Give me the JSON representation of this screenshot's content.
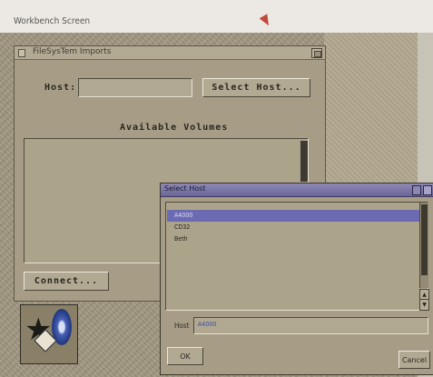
{
  "screen": {
    "title": "Workbench Screen"
  },
  "main_window": {
    "title": "FileSysTem Imports",
    "host_label": "Host:",
    "host_value": "",
    "select_host_button": "Select Host...",
    "volumes_heading": "Available Volumes",
    "volumes": [],
    "connect_button": "Connect..."
  },
  "select_host_dialog": {
    "title": "Select Host",
    "hosts": [
      {
        "name": "A4000",
        "selected": true
      },
      {
        "name": "CD32",
        "selected": false
      },
      {
        "name": "Beth",
        "selected": false
      }
    ],
    "host_label": "Host",
    "host_value": "A4000",
    "ok_button": "OK",
    "cancel_button": "Cancel"
  },
  "icons": {
    "close": "close-gadget",
    "depth": "depth-gadget",
    "scroll_up": "arrow-up",
    "scroll_down": "arrow-down"
  },
  "colors": {
    "window_bg": "#a79d86",
    "dialog_titlebar": "#6b6699",
    "selection": "#6d6ab4"
  }
}
